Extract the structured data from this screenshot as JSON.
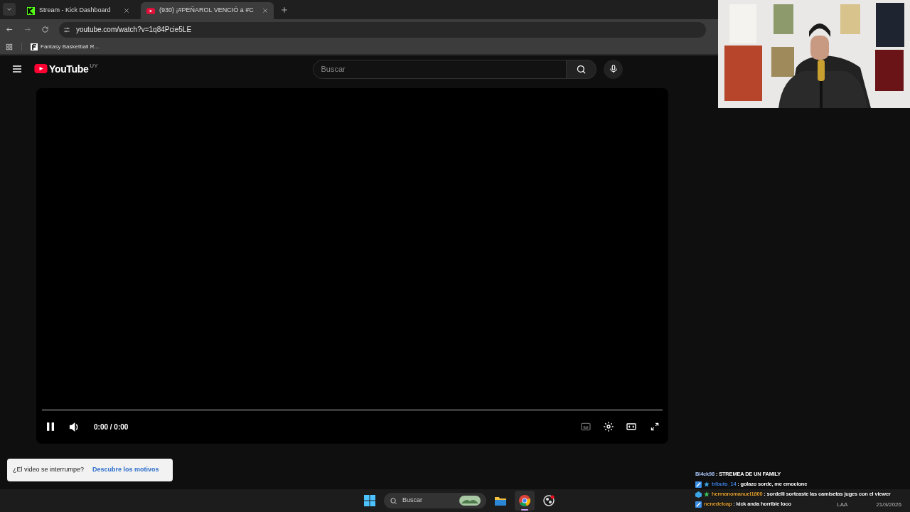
{
  "tabs": [
    {
      "label": "Stream - Kick Dashboard",
      "kind": "kick",
      "selected": false
    },
    {
      "label": "(930) ¡#PEÑAROL VENCIÓ a #C",
      "kind": "youtube",
      "selected": true
    }
  ],
  "address": "youtube.com/watch?v=1q84Pcie5LE",
  "bookmarks": [
    "Fantasy Basketball R..."
  ],
  "youtube": {
    "logo": "YouTube",
    "region": "UY",
    "search_placeholder": "Buscar"
  },
  "player": {
    "playing": true,
    "time": "0:00 / 0:00"
  },
  "toast": {
    "text": "¿El video se interrumpe?",
    "link": "Descubre los motivos"
  },
  "chat": [
    {
      "user": "Bl4ck98",
      "message": ": STREMEA DE UN FAMILY",
      "color": "#a9c4f5"
    },
    {
      "user": "tributo_14",
      "message": ": golazo sorde, me emocione",
      "color": "#3f7fd9",
      "badges": [
        {
          "kind": "sub"
        },
        {
          "kind": "star"
        }
      ]
    },
    {
      "user": "hermanomanuel1800",
      "message": ": sordelli sorteaste las camisetas juges con el viewer",
      "color": "#e0a030",
      "badges": [
        {
          "kind": "cube"
        },
        {
          "kind": "green-star"
        }
      ]
    },
    {
      "user": "nenedelcap",
      "message": ": kick anda horrible loco",
      "color": "#e0a030",
      "badges": [
        {
          "kind": "sub"
        }
      ]
    }
  ],
  "taskbar": {
    "search_placeholder": "Buscar",
    "apps": [
      {
        "kind": "files",
        "selected": false
      },
      {
        "kind": "chrome",
        "selected": true
      },
      {
        "kind": "obs",
        "selected": false
      }
    ]
  },
  "tray": {
    "language": "LAA",
    "date": "21/3/2026"
  }
}
